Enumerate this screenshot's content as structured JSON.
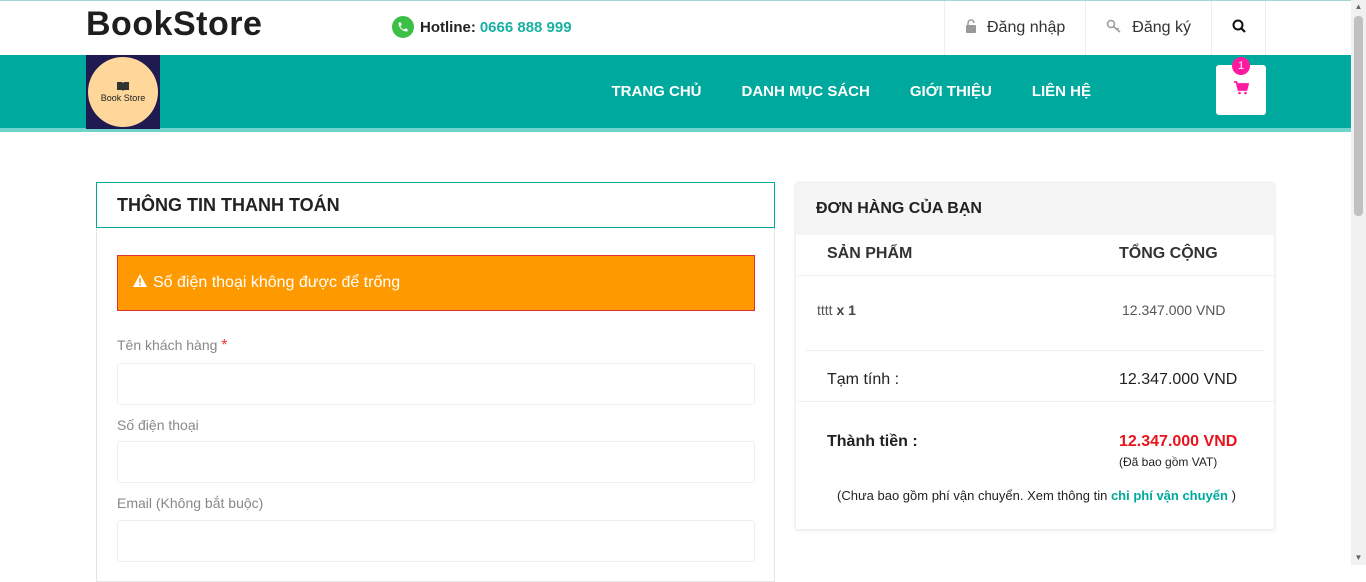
{
  "header": {
    "brand": "BookStore",
    "hotline_label": "Hotline:",
    "hotline_number": "0666 888 999",
    "login": "Đăng nhập",
    "register": "Đăng ký"
  },
  "nav": {
    "logo_text": "Book Store",
    "items": [
      "TRANG CHỦ",
      "DANH MỤC SÁCH",
      "GIỚI THIỆU",
      "LIÊN HỆ"
    ],
    "cart_count": "1"
  },
  "billing": {
    "title": "THÔNG TIN THANH TOÁN",
    "alert": "Số điện thoại không được để trống",
    "name_label": "Tên khách hàng",
    "required_mark": "*",
    "phone_label": "Số điện thoại",
    "email_label": "Email (Không bắt buộc)"
  },
  "order": {
    "title": "ĐƠN HÀNG CỦA BẠN",
    "col_product": "SẢN PHẨM",
    "col_total": "TỔNG CỘNG",
    "item_name": "tttt",
    "item_qty": "x 1",
    "item_price": "12.347.000 VND",
    "subtotal_label": "Tạm tính :",
    "subtotal_value": "12.347.000 VND",
    "total_label": "Thành tiền :",
    "total_value": "12.347.000 VND",
    "vat_note": "(Đã bao gồm VAT)",
    "ship_note_prefix": "(Chưa bao gồm phí vận chuyển. Xem thông tin",
    "ship_link": "chi phí vận chuyển",
    "ship_note_suffix": ")"
  },
  "colors": {
    "accent": "#00a99d",
    "alert": "#ff9900",
    "total": "#e8141d",
    "badge": "#ff1aa0"
  }
}
